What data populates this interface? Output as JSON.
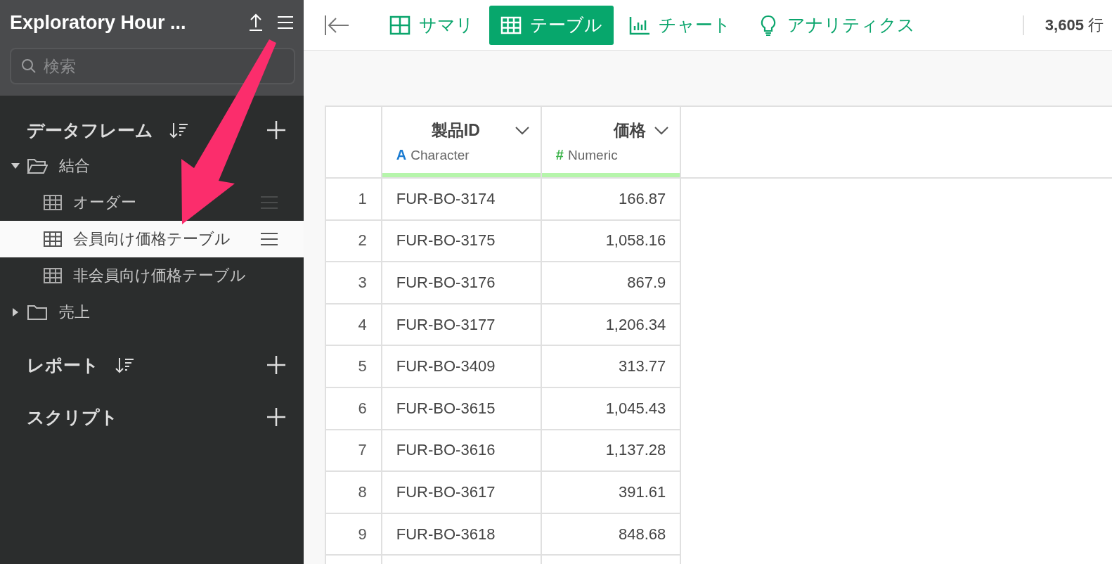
{
  "sidebar": {
    "title": "Exploratory Hour ...",
    "search": {
      "placeholder": "検索"
    },
    "sections": [
      {
        "title": "データフレーム",
        "sortable": true,
        "tree": [
          {
            "kind": "folder",
            "label": "結合",
            "expanded": true,
            "children": [
              {
                "kind": "table",
                "label": "オーダー",
                "selected": false,
                "hovered": true
              },
              {
                "kind": "table",
                "label": "会員向け価格テーブル",
                "selected": true
              },
              {
                "kind": "table",
                "label": "非会員向け価格テーブル",
                "selected": false
              }
            ]
          },
          {
            "kind": "folder",
            "label": "売上",
            "expanded": false
          }
        ]
      },
      {
        "title": "レポート",
        "sortable": true
      },
      {
        "title": "スクリプト",
        "sortable": false
      }
    ]
  },
  "toolbar": {
    "tabs": [
      {
        "kind": "summary",
        "label": "サマリ",
        "selected": false
      },
      {
        "kind": "table",
        "label": "テーブル",
        "selected": true
      },
      {
        "kind": "chart",
        "label": "チャート",
        "selected": false
      },
      {
        "kind": "analytics",
        "label": "アナリティクス",
        "selected": false
      }
    ],
    "row_count": "**3,605** 行"
  },
  "table": {
    "columns": [
      {
        "kind": "index"
      },
      {
        "name": "製品ID",
        "type": "Character",
        "type_mark": "A",
        "kind": "character"
      },
      {
        "name": "価格",
        "type": "Numeric",
        "type_mark": "#",
        "kind": "numeric"
      }
    ],
    "rows": [
      [
        "1",
        "FUR-BO-3174",
        "166.87"
      ],
      [
        "2",
        "FUR-BO-3175",
        "1,058.16"
      ],
      [
        "3",
        "FUR-BO-3176",
        "867.9"
      ],
      [
        "4",
        "FUR-BO-3177",
        "1,206.34"
      ],
      [
        "5",
        "FUR-BO-3409",
        "313.77"
      ],
      [
        "6",
        "FUR-BO-3615",
        "1,045.43"
      ],
      [
        "7",
        "FUR-BO-3616",
        "1,137.28"
      ],
      [
        "8",
        "FUR-BO-3617",
        "391.61"
      ],
      [
        "9",
        "FUR-BO-3618",
        "848.68"
      ]
    ]
  }
}
